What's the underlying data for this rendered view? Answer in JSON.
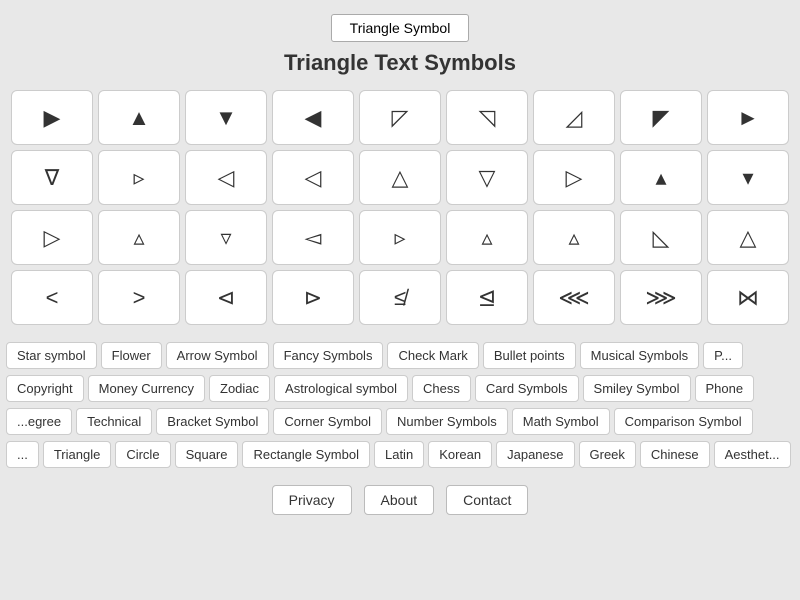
{
  "header": {
    "top_button": "Triangle Symbol",
    "title": "Triangle Text Symbols"
  },
  "symbols": {
    "rows": [
      [
        "▶",
        "▲",
        "▼",
        "◀",
        "◸",
        "◹",
        "◿",
        "◤",
        "▶"
      ],
      [
        "▽",
        "▷",
        "◁",
        "◁",
        "△",
        "▽",
        "▷",
        "▴",
        "▾"
      ],
      [
        "▷",
        "△",
        "▿",
        "◁",
        "▹",
        "▵",
        "▵",
        "◺",
        "△"
      ],
      [
        "<",
        ">",
        "⊲",
        "⊳",
        "≮",
        "⊴",
        "⋘",
        "⋙",
        "⋈"
      ]
    ]
  },
  "nav_rows": [
    [
      "Star symbol",
      "Flower",
      "Arrow Symbol",
      "Fancy Symbols",
      "Check Mark",
      "Bullet points",
      "Musical Symbols",
      "P..."
    ],
    [
      "Copyright",
      "Money Currency",
      "Zodiac",
      "Astrological symbol",
      "Chess",
      "Card Symbols",
      "Smiley Symbol",
      "Phone"
    ],
    [
      "...egree",
      "Technical",
      "Bracket Symbol",
      "Corner Symbol",
      "Number Symbols",
      "Math Symbol",
      "Comparison Symbol"
    ],
    [
      "...",
      "Triangle",
      "Circle",
      "Square",
      "Rectangle Symbol",
      "Latin",
      "Korean",
      "Japanese",
      "Greek",
      "Chinese",
      "Aesthet..."
    ]
  ],
  "footer": {
    "links": [
      "Privacy",
      "About",
      "Contact"
    ]
  }
}
